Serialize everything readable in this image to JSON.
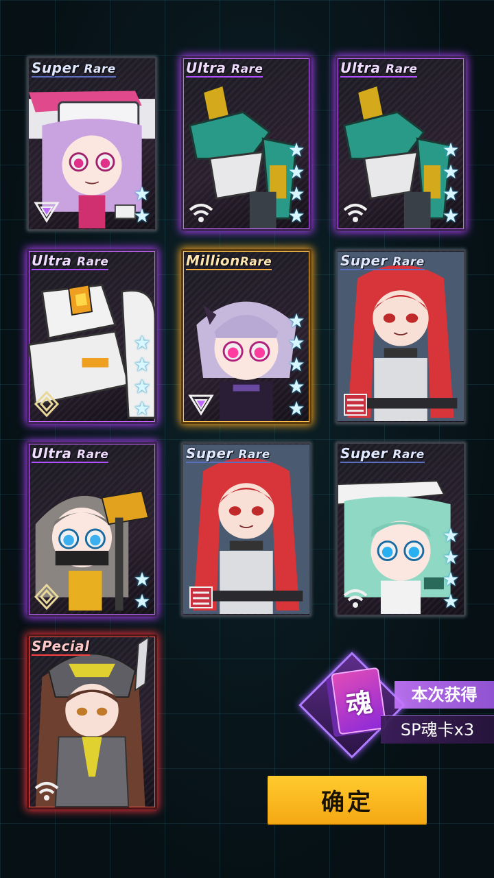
{
  "cards": [
    {
      "rarity": "Super",
      "rarity_suffix": "Rare",
      "tier": "sr",
      "stars": 2,
      "class_icon": "triangle-class-icon",
      "subject": "chibi girl with pink hat"
    },
    {
      "rarity": "Ultra",
      "rarity_suffix": "Rare",
      "tier": "ur",
      "stars": 4,
      "class_icon": "wifi-class-icon",
      "subject": "green mecha"
    },
    {
      "rarity": "Ultra",
      "rarity_suffix": "Rare",
      "tier": "ur",
      "stars": 4,
      "class_icon": "wifi-class-icon",
      "subject": "green mecha"
    },
    {
      "rarity": "Ultra",
      "rarity_suffix": "Rare",
      "tier": "ur",
      "stars": 4,
      "class_icon": "diamond-class-icon",
      "subject": "white orange mecha"
    },
    {
      "rarity": "Million",
      "rarity_suffix": "Rare",
      "tier": "mr",
      "stars": 5,
      "class_icon": "triangle-class-icon",
      "subject": "chibi purple haired girl"
    },
    {
      "rarity": "Super",
      "rarity_suffix": "Rare",
      "tier": "sr",
      "stars": 0,
      "class_icon": "flag-class-icon",
      "subject": "red twintail girl"
    },
    {
      "rarity": "Ultra",
      "rarity_suffix": "Rare",
      "tier": "ur",
      "stars": 2,
      "class_icon": "diamond-class-icon",
      "subject": "chibi girl with hammer"
    },
    {
      "rarity": "Super",
      "rarity_suffix": "Rare",
      "tier": "sr",
      "stars": 0,
      "class_icon": "flag-class-icon",
      "subject": "red twintail girl"
    },
    {
      "rarity": "Super",
      "rarity_suffix": "Rare",
      "tier": "sr",
      "stars": 4,
      "class_icon": "wifi-class-icon",
      "subject": "chibi green haired girl"
    },
    {
      "rarity": "SPecial",
      "rarity_suffix": "",
      "tier": "sp",
      "stars": 0,
      "class_icon": "wifi-class-icon",
      "subject": "brown haired hooded girl"
    }
  ],
  "reward": {
    "icon_char": "魂",
    "label": "本次获得",
    "item": "SP魂卡x3"
  },
  "confirm_label": "确定",
  "colors": {
    "ultra": "#a23ee8",
    "million": "#f0a324",
    "special": "#e8323c",
    "button": "#ffcb2e"
  }
}
